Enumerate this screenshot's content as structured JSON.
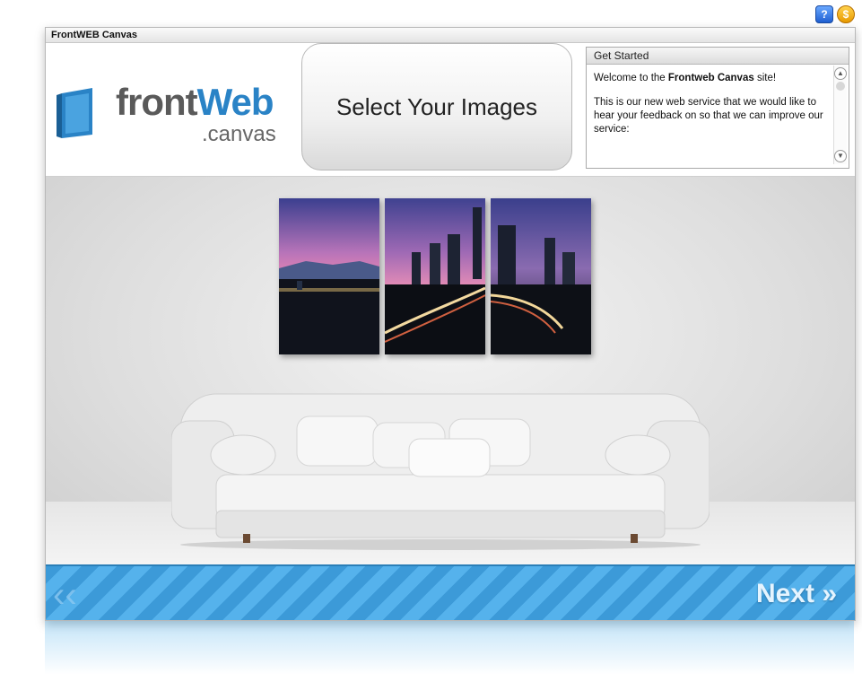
{
  "window": {
    "title": "FrontWEB Canvas"
  },
  "top_icons": [
    {
      "name": "help-icon",
      "glyph": "?"
    },
    {
      "name": "coin-icon",
      "glyph": "$"
    }
  ],
  "logo": {
    "main_gray": "front",
    "main_blue": "Web",
    "sub": ".canvas"
  },
  "header": {
    "step_title": "Select Your Images"
  },
  "info_panel": {
    "title": "Get Started",
    "welcome_prefix": "Welcome to the ",
    "welcome_bold": "Frontweb Canvas",
    "welcome_suffix": " site!",
    "body": "This is our new web service that we would like to hear your feedback on so that we can improve our service:"
  },
  "nav": {
    "back_glyph": "‹‹",
    "next_label": "Next",
    "next_glyph": "»"
  },
  "colors": {
    "brand_blue": "#2a83c6",
    "nav_blue": "#3c9ad8"
  }
}
